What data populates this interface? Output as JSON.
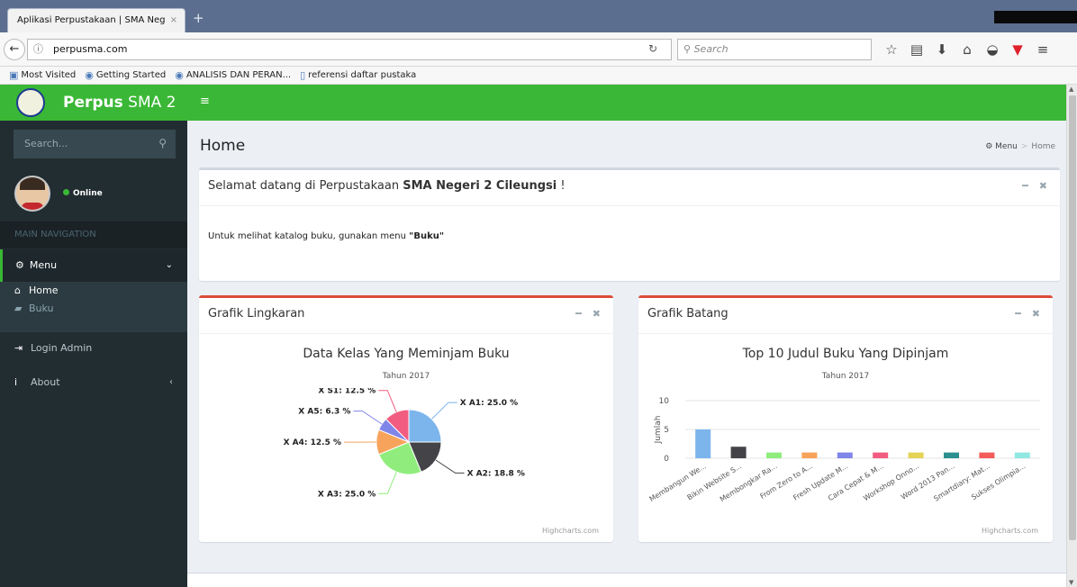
{
  "browser": {
    "tab_title": "Aplikasi Perpustakaan | SMA Neg",
    "tab_close": "×",
    "new_tab": "+",
    "url": "perpusma.com",
    "search_placeholder": "Search",
    "bookmarks": [
      "Most Visited",
      "Getting Started",
      "ANALISIS DAN PERAN...",
      "referensi daftar pustaka"
    ]
  },
  "sidebar": {
    "brand_bold": "Perpus",
    "brand_rest": "SMA 2",
    "search_placeholder": "Search...",
    "status": "Online",
    "section_header": "MAIN NAVIGATION",
    "menu_label": "Menu",
    "sub_items": [
      "Home",
      "Buku"
    ],
    "login_admin": "Login Admin",
    "about": "About"
  },
  "content": {
    "page_title": "Home",
    "breadcrumb": [
      "Menu",
      "Home"
    ],
    "welcome_prefix": "Selamat datang di Perpustakaan ",
    "welcome_school": "SMA Negeri 2 Cileungsi",
    "welcome_suffix": " !",
    "welcome_body_prefix": "Untuk melihat katalog buku, gunakan menu ",
    "welcome_body_bold": "\"Buku\"",
    "pie_box_title": "Grafik Lingkaran",
    "bar_box_title": "Grafik Batang",
    "credits": "Highcharts.com"
  },
  "colors": {
    "brand_green": "#3ab736",
    "sidebar_bg": "#222d32",
    "box_red": "#dd4b39"
  },
  "chart_data": [
    {
      "type": "pie",
      "title": "Data Kelas Yang Meminjam Buku",
      "subtitle": "Tahun 2017",
      "slices": [
        {
          "name": "X A1",
          "value": 25.0,
          "label": "X A1: 25.0 %",
          "color": "#7cb5ec"
        },
        {
          "name": "X A2",
          "value": 18.8,
          "label": "X A2: 18.8 %",
          "color": "#434348"
        },
        {
          "name": "X A3",
          "value": 25.0,
          "label": "X A3: 25.0 %",
          "color": "#90ed7d"
        },
        {
          "name": "X A4",
          "value": 12.5,
          "label": "X A4: 12.5 %",
          "color": "#f7a35c"
        },
        {
          "name": "X A5",
          "value": 6.3,
          "label": "X A5: 6.3 %",
          "color": "#8085e9"
        },
        {
          "name": "X S1",
          "value": 12.5,
          "label": "X S1: 12.5 %",
          "color": "#f15c80"
        }
      ]
    },
    {
      "type": "bar",
      "title": "Top 10 Judul Buku Yang Dipinjam",
      "subtitle": "Tahun 2017",
      "ylabel": "Jumlah",
      "ylim": [
        0,
        10
      ],
      "yticks": [
        0,
        5,
        10
      ],
      "categories": [
        "Membangun We...",
        "Bikin Website S...",
        "Membongkar Ra...",
        "From Zero to A...",
        "Fresh Update M...",
        "Cara Cepat & M...",
        "Workshop Onno...",
        "Word 2013 Pan...",
        "Smartdiary: Mat...",
        "Sukses Olimpia..."
      ],
      "values": [
        5,
        2,
        1,
        1,
        1,
        1,
        1,
        1,
        1,
        1
      ],
      "colors": [
        "#7cb5ec",
        "#434348",
        "#90ed7d",
        "#f7a35c",
        "#8085e9",
        "#f15c80",
        "#e4d354",
        "#2b908f",
        "#f45b5b",
        "#91e8e1"
      ]
    }
  ]
}
